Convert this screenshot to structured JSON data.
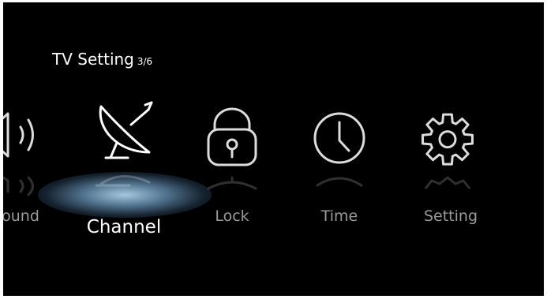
{
  "header": {
    "title": "TV Setting",
    "page_indicator": "3/6"
  },
  "menu": {
    "items": [
      {
        "label": "Sound",
        "visible_label": "ound",
        "icon": "speaker-icon",
        "selected": false
      },
      {
        "label": "Channel",
        "icon": "satellite-dish-icon",
        "selected": true
      },
      {
        "label": "Lock",
        "icon": "padlock-icon",
        "selected": false
      },
      {
        "label": "Time",
        "icon": "clock-icon",
        "selected": false
      },
      {
        "label": "Setting",
        "icon": "gear-icon",
        "selected": false
      }
    ]
  },
  "colors": {
    "background": "#000000",
    "text_active": "#ffffff",
    "text_inactive": "#9a9a9a",
    "highlight_glow": "#8fb9d6"
  }
}
